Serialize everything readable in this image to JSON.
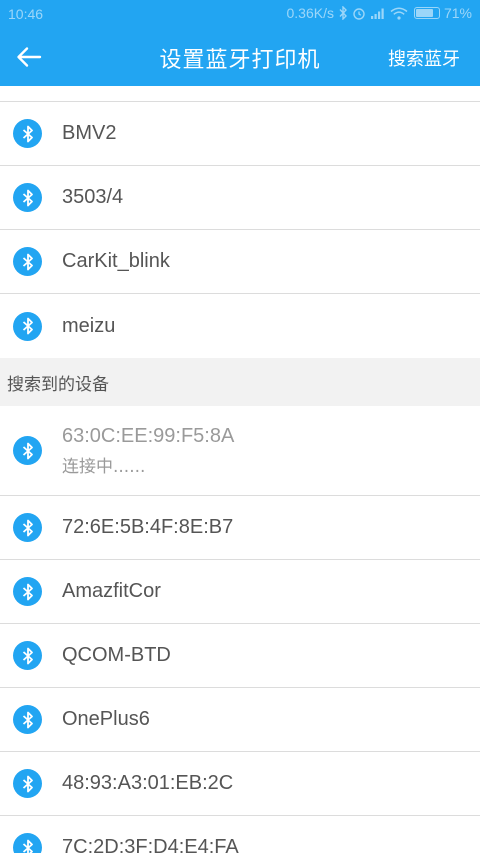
{
  "status_bar": {
    "time": "10:46",
    "net_speed": "0.36K/s",
    "battery": "71%"
  },
  "header": {
    "title": "设置蓝牙打印机",
    "action_label": "搜索蓝牙",
    "back_icon": "arrow-left-icon"
  },
  "paired_devices": [
    {
      "name": "BMV2"
    },
    {
      "name": "3503/4"
    },
    {
      "name": "CarKit_blink"
    },
    {
      "name": "meizu"
    }
  ],
  "found_section": {
    "title": "搜索到的设备"
  },
  "found_devices": [
    {
      "name": "63:0C:EE:99:F5:8A",
      "status": "连接中......"
    },
    {
      "name": "72:6E:5B:4F:8E:B7"
    },
    {
      "name": "AmazfitCor"
    },
    {
      "name": "QCOM-BTD"
    },
    {
      "name": "OnePlus6"
    },
    {
      "name": "48:93:A3:01:EB:2C"
    },
    {
      "name": "7C:2D:3F:D4:E4:FA"
    }
  ],
  "colors": {
    "primary": "#22a5f2",
    "text": "#555555",
    "muted": "#9a9a9a",
    "divider": "#dcdcdc"
  }
}
